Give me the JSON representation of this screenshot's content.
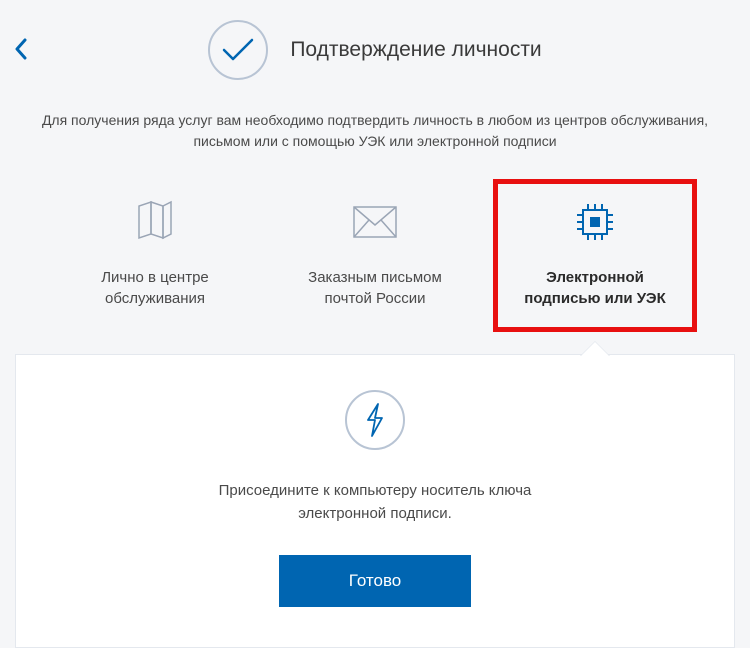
{
  "header": {
    "title": "Подтверждение личности"
  },
  "description": {
    "line1": "Для получения ряда услуг вам необходимо подтвердить личность в любом из центров обслуживания,",
    "line2": "письмом или с помощью УЭК или электронной подписи"
  },
  "options": [
    {
      "label_line1": "Лично в центре",
      "label_line2": "обслуживания",
      "icon": "map-icon"
    },
    {
      "label_line1": "Заказным письмом",
      "label_line2": "почтой России",
      "icon": "envelope-icon"
    },
    {
      "label_line1": "Электронной",
      "label_line2": "подписью или УЭК",
      "icon": "chip-icon",
      "selected": true
    }
  ],
  "panel": {
    "text_line1": "Присоедините к компьютеру носитель ключа",
    "text_line2": "электронной подписи.",
    "button": "Готово"
  },
  "colors": {
    "accent": "#0065b1",
    "highlight": "#e81010"
  }
}
